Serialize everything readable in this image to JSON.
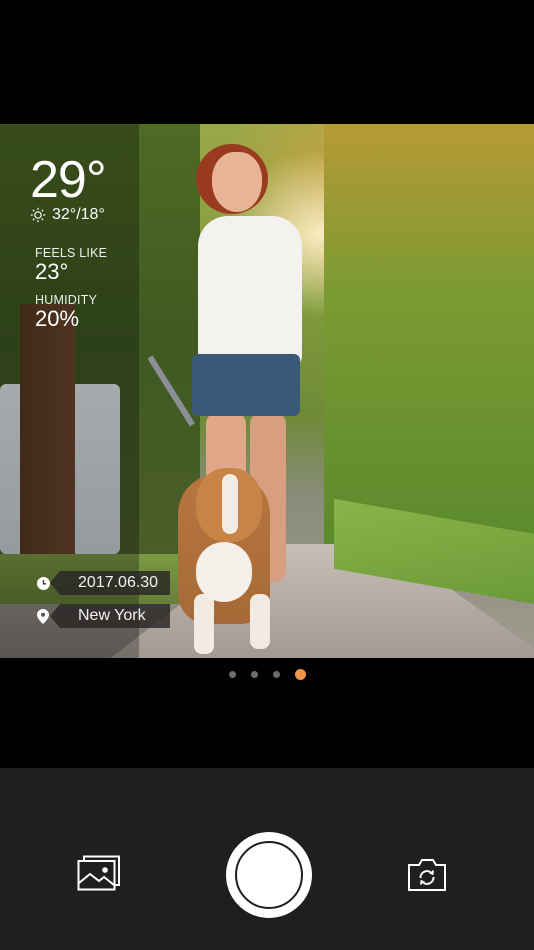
{
  "weather": {
    "temperature": "29°",
    "high_low": "32°/18°",
    "feels_like_label": "FEELS LIKE",
    "feels_like_value": "23°",
    "humidity_label": "HUMIDITY",
    "humidity_value": "20%"
  },
  "stamp": {
    "date": "2017.06.30",
    "location": "New York"
  },
  "pager": {
    "count": 4,
    "active_index": 3,
    "active_color": "#f0954a",
    "inactive_color": "#6d6d6d"
  },
  "toolbar": {
    "gallery_icon": "gallery-icon",
    "shutter": "shutter-button",
    "flip_icon": "switch-camera-icon"
  }
}
